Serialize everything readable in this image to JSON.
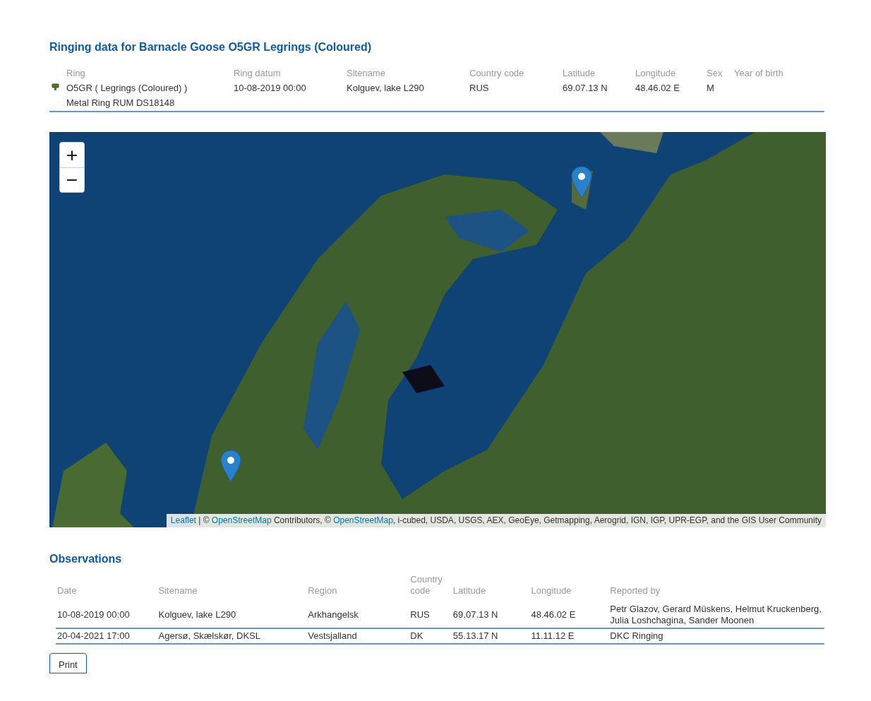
{
  "title": "Ringing data for Barnacle Goose O5GR Legrings (Coloured)",
  "ring_table": {
    "columns": [
      "Ring",
      "Ring datum",
      "Sitename",
      "Country code",
      "Latitude",
      "Longitude",
      "Sex",
      "Year of birth"
    ],
    "rows": [
      {
        "metal_ring": "Metal Ring RUM DS18148",
        "cells": [
          "O5GR ( Legrings (Coloured) )",
          "10-08-2019 00:00",
          "Kolguev, lake L290",
          "RUS",
          "69.07.13 N",
          "48.46.02 E",
          "M"
        ]
      }
    ]
  },
  "map": {
    "zoom_in": "+",
    "zoom_out": "−",
    "attribution": [
      {
        "kind": "link",
        "text": "Leaflet"
      },
      {
        "kind": "text",
        "text": " | © "
      },
      {
        "kind": "link",
        "text": "OpenStreetMap"
      },
      {
        "kind": "text",
        "text": " Contributors, © "
      },
      {
        "kind": "link",
        "text": "OpenStreetMap"
      },
      {
        "kind": "text",
        "text": ", i-cubed, USDA, USGS, AEX, GeoEye, Getmapping, Aerogrid, IGN, IGP, UPR-EGP, and the GIS User Community"
      }
    ]
  },
  "observations": {
    "title": "Observations",
    "columns": [
      "Date",
      "Sitename",
      "Region",
      "Country code",
      "Latitude",
      "Longitude",
      "Reported by"
    ],
    "rows": [
      [
        "10-08-2019 00:00",
        "Kolguev, lake L290",
        "Arkhangelsk",
        "RUS",
        "69.07.13 N",
        "48.46.02 E",
        "Petr Glazov, Gerard Müskens, Helmut Kruckenberg, Julia Loshchagina, Sander Moonen"
      ],
      [
        "20-04-2021 17:00",
        "Agersø, Skælskør, DKSL",
        "Vestsjalland",
        "DK",
        "55.13.17 N",
        "11.11.12 E",
        "DKC Ringing"
      ]
    ]
  },
  "print_button": "Print"
}
